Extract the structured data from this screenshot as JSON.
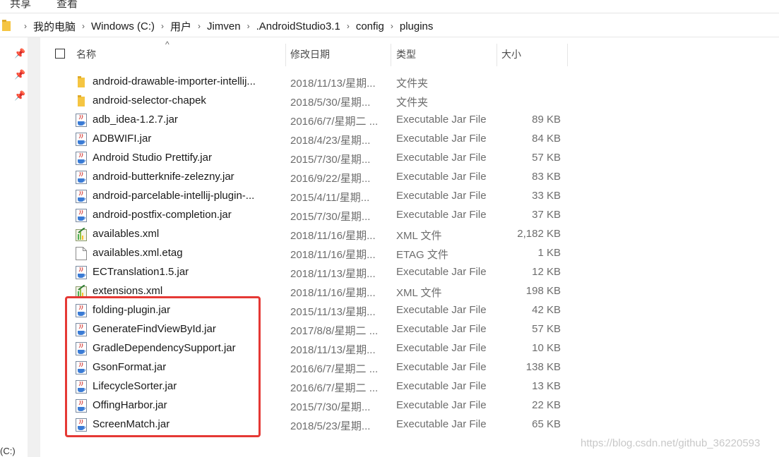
{
  "ribbon": {
    "tab_share": "共享",
    "tab_view": "查看"
  },
  "breadcrumb": [
    "我的电脑",
    "Windows (C:)",
    "用户",
    "Jimven",
    ".AndroidStudio3.1",
    "config",
    "plugins"
  ],
  "nav": {
    "bottom_label": "(C:)"
  },
  "columns": {
    "name": "名称",
    "date": "修改日期",
    "type": "类型",
    "size": "大小"
  },
  "files": [
    {
      "name": "android-drawable-importer-intellij...",
      "date": "2018/11/13/星期...",
      "type": "文件夹",
      "size": "",
      "icon": "folder-icon"
    },
    {
      "name": "android-selector-chapek",
      "date": "2018/5/30/星期...",
      "type": "文件夹",
      "size": "",
      "icon": "folder-icon"
    },
    {
      "name": "adb_idea-1.2.7.jar",
      "date": "2016/6/7/星期二 ...",
      "type": "Executable Jar File",
      "size": "89 KB",
      "icon": "jar-icon"
    },
    {
      "name": "ADBWIFI.jar",
      "date": "2018/4/23/星期...",
      "type": "Executable Jar File",
      "size": "84 KB",
      "icon": "jar-icon"
    },
    {
      "name": "Android Studio Prettify.jar",
      "date": "2015/7/30/星期...",
      "type": "Executable Jar File",
      "size": "57 KB",
      "icon": "jar-icon"
    },
    {
      "name": "android-butterknife-zelezny.jar",
      "date": "2016/9/22/星期...",
      "type": "Executable Jar File",
      "size": "83 KB",
      "icon": "jar-icon"
    },
    {
      "name": "android-parcelable-intellij-plugin-...",
      "date": "2015/4/11/星期...",
      "type": "Executable Jar File",
      "size": "33 KB",
      "icon": "jar-icon"
    },
    {
      "name": "android-postfix-completion.jar",
      "date": "2015/7/30/星期...",
      "type": "Executable Jar File",
      "size": "37 KB",
      "icon": "jar-icon"
    },
    {
      "name": "availables.xml",
      "date": "2018/11/16/星期...",
      "type": "XML 文件",
      "size": "2,182 KB",
      "icon": "xml-icon"
    },
    {
      "name": "availables.xml.etag",
      "date": "2018/11/16/星期...",
      "type": "ETAG 文件",
      "size": "1 KB",
      "icon": "blank-file-icon"
    },
    {
      "name": "ECTranslation1.5.jar",
      "date": "2018/11/13/星期...",
      "type": "Executable Jar File",
      "size": "12 KB",
      "icon": "jar-icon"
    },
    {
      "name": "extensions.xml",
      "date": "2018/11/16/星期...",
      "type": "XML 文件",
      "size": "198 KB",
      "icon": "xml-icon"
    },
    {
      "name": "folding-plugin.jar",
      "date": "2015/11/13/星期...",
      "type": "Executable Jar File",
      "size": "42 KB",
      "icon": "jar-icon"
    },
    {
      "name": "GenerateFindViewById.jar",
      "date": "2017/8/8/星期二 ...",
      "type": "Executable Jar File",
      "size": "57 KB",
      "icon": "jar-icon"
    },
    {
      "name": "GradleDependencySupport.jar",
      "date": "2018/11/13/星期...",
      "type": "Executable Jar File",
      "size": "10 KB",
      "icon": "jar-icon"
    },
    {
      "name": "GsonFormat.jar",
      "date": "2016/6/7/星期二 ...",
      "type": "Executable Jar File",
      "size": "138 KB",
      "icon": "jar-icon"
    },
    {
      "name": "LifecycleSorter.jar",
      "date": "2016/6/7/星期二 ...",
      "type": "Executable Jar File",
      "size": "13 KB",
      "icon": "jar-icon"
    },
    {
      "name": "OffingHarbor.jar",
      "date": "2015/7/30/星期...",
      "type": "Executable Jar File",
      "size": "22 KB",
      "icon": "jar-icon"
    },
    {
      "name": "ScreenMatch.jar",
      "date": "2018/5/23/星期...",
      "type": "Executable Jar File",
      "size": "65 KB",
      "icon": "jar-icon"
    }
  ],
  "watermark": "https://blog.csdn.net/github_36220593",
  "colors": {
    "highlight": "#e53935",
    "folder": "#f5c542"
  }
}
